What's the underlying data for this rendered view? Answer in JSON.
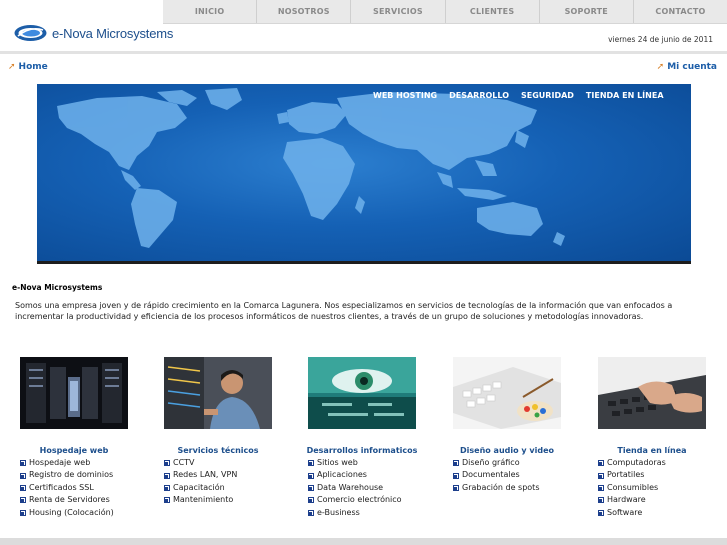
{
  "nav": {
    "items": [
      "INICIO",
      "NOSOTROS",
      "SERVICIOS",
      "CLIENTES",
      "SOPORTE",
      "CONTACTO"
    ]
  },
  "logo": {
    "text": "e-Nova Microsystems"
  },
  "date": "viernes 24 de junio de 2011",
  "links": {
    "home": "Home",
    "account": "Mi cuenta"
  },
  "banner": {
    "menu": [
      "WEB HOSTING",
      "DESARROLLO",
      "SEGURIDAD",
      "TIENDA EN LÍNEA"
    ]
  },
  "company": {
    "title": "e-Nova Microsystems",
    "intro": "Somos una empresa joven y de rápido crecimiento en la Comarca Lagunera. Nos especializamos en servicios de tecnologías de la información que van enfocados a incrementar la productividad y eficiencia de los procesos informáticos de nuestros clientes, a través de un grupo de soluciones y metodologías innovadoras."
  },
  "columns": [
    {
      "title": "Hospedaje web",
      "items": [
        "Hospedaje web",
        "Registro de dominios",
        "Certificados SSL",
        "Renta de Servidores",
        "Housing (Colocación)"
      ]
    },
    {
      "title": "Servicios técnicos",
      "items": [
        "CCTV",
        "Redes LAN, VPN",
        "Capacitación",
        "Mantenimiento"
      ]
    },
    {
      "title": "Desarrollos informaticos",
      "items": [
        "Sitios web",
        "Aplicaciones",
        "Data Warehouse",
        "Comercio electrónico",
        "e-Business"
      ]
    },
    {
      "title": "Diseño audio y video",
      "items": [
        "Diseño gráfico",
        "Documentales",
        "Grabación de spots"
      ]
    },
    {
      "title": "Tienda en línea",
      "items": [
        "Computadoras",
        "Portatiles",
        "Consumibles",
        "Hardware",
        "Software"
      ]
    }
  ],
  "colors": {
    "link": "#1d5ea8",
    "heading": "#1d4f8c",
    "banner": "#1561b5",
    "accent_arrow": "#d8822a"
  }
}
